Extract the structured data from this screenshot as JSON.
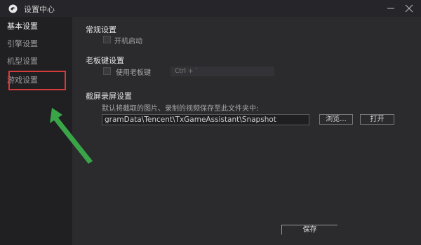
{
  "window": {
    "title": "设置中心"
  },
  "sidebar": {
    "items": [
      {
        "label": "基本设置",
        "active": true
      },
      {
        "label": "引擎设置",
        "active": false
      },
      {
        "label": "机型设置",
        "active": false
      },
      {
        "label": "游戏设置",
        "active": false
      }
    ]
  },
  "general": {
    "title": "常规设置",
    "autostart_label": "开机启动",
    "autostart_checked": false
  },
  "boss_key": {
    "title": "老板键设置",
    "use_label": "使用老板键",
    "use_checked": false,
    "hotkey_value": "Ctrl + `"
  },
  "screenshot": {
    "title": "截屏录屏设置",
    "description": "默认将截取的图片、录制的视频保存至此文件夹中:",
    "path_value": "gramData\\Tencent\\TxGameAssistant\\Snapshot",
    "browse_label": "浏览...",
    "open_label": "打开"
  },
  "footer": {
    "save_label": "保存"
  },
  "colors": {
    "highlight_box": "#d63a3a",
    "annotation_arrow": "#3aa548"
  }
}
